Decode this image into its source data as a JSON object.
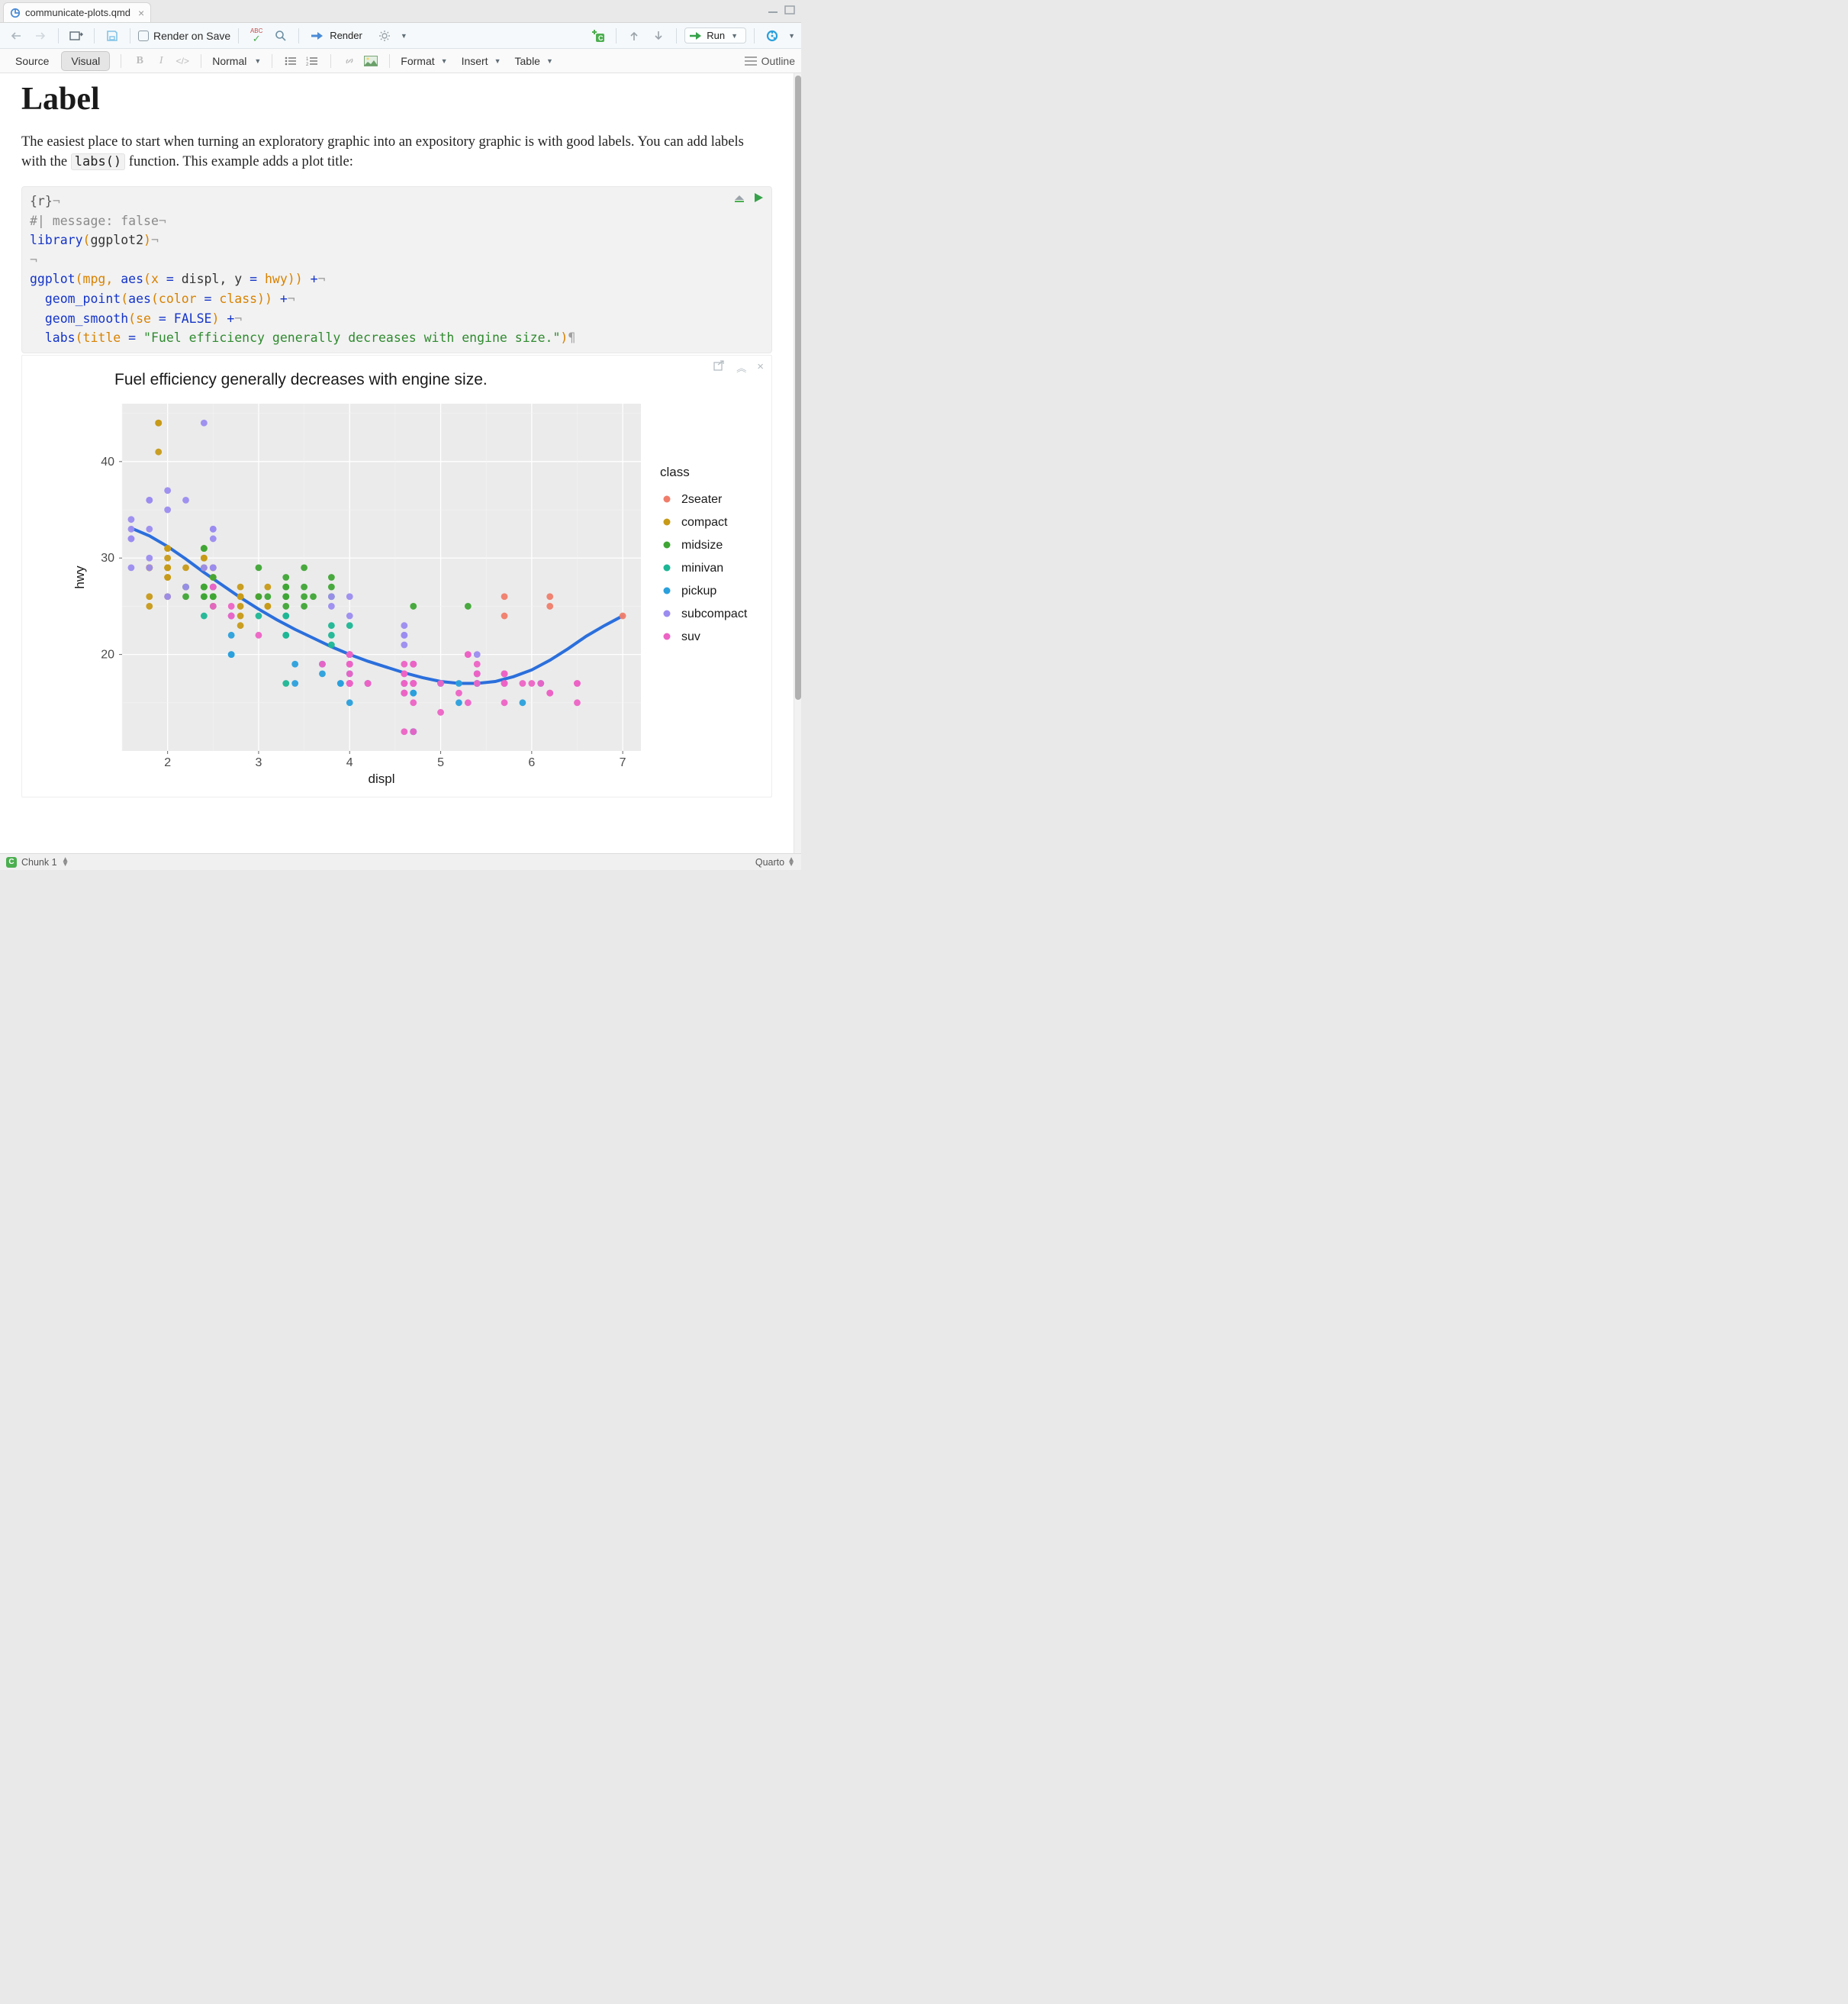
{
  "tab": {
    "filename": "communicate-plots.qmd"
  },
  "toolbar": {
    "render_on_save": "Render on Save",
    "render": "Render",
    "run": "Run"
  },
  "toolbar2": {
    "source": "Source",
    "visual": "Visual",
    "style_select": "Normal",
    "format": "Format",
    "insert": "Insert",
    "table": "Table",
    "outline": "Outline"
  },
  "page": {
    "heading": "Label",
    "para_pre": "The easiest place to start when turning an exploratory graphic into an expository graphic is with good labels. You can add labels with the ",
    "para_code": "labs()",
    "para_post": " function. This example adds a plot title:"
  },
  "code": {
    "l1": "{r}",
    "l2": "#| message: false",
    "l3a": "library",
    "l3b": "(",
    "l3c": "ggplot2",
    "l3d": ")",
    "l5a": "ggplot",
    "l5b": "(mpg, ",
    "l5c": "aes",
    "l5d": "(x ",
    "l5e": "=",
    "l5f": " displ, y ",
    "l5g": "=",
    "l5h": " hwy)) ",
    "l5i": "+",
    "l6a": "  geom_point",
    "l6b": "(",
    "l6c": "aes",
    "l6d": "(color ",
    "l6e": "=",
    "l6f": " class)) ",
    "l6g": "+",
    "l7a": "  geom_smooth",
    "l7b": "(se ",
    "l7c": "=",
    "l7d": " ",
    "l7e": "FALSE",
    "l7f": ") ",
    "l7g": "+",
    "l8a": "  labs",
    "l8b": "(title ",
    "l8c": "=",
    "l8d": " ",
    "l8e": "\"Fuel efficiency generally decreases with engine size.\"",
    "l8f": ")"
  },
  "status": {
    "chunk": "Chunk 1",
    "engine": "Quarto"
  },
  "chart_data": {
    "type": "scatter",
    "title": "Fuel efficiency generally decreases with engine size.",
    "xlabel": "displ",
    "ylabel": "hwy",
    "xlim": [
      1.5,
      7.2
    ],
    "ylim": [
      10,
      46
    ],
    "x_ticks": [
      2,
      3,
      4,
      5,
      6,
      7
    ],
    "y_ticks": [
      20,
      30,
      40
    ],
    "legend_title": "class",
    "series": [
      {
        "name": "2seater",
        "color": "#f07d6a",
        "points": [
          [
            5.7,
            26
          ],
          [
            5.7,
            24
          ],
          [
            6.2,
            26
          ],
          [
            6.2,
            25
          ],
          [
            7.0,
            24
          ]
        ]
      },
      {
        "name": "compact",
        "color": "#c79a17",
        "points": [
          [
            1.8,
            29
          ],
          [
            1.8,
            29
          ],
          [
            2.0,
            31
          ],
          [
            2.0,
            30
          ],
          [
            2.8,
            26
          ],
          [
            2.8,
            26
          ],
          [
            3.1,
            27
          ],
          [
            1.8,
            26
          ],
          [
            1.8,
            25
          ],
          [
            2.0,
            28
          ],
          [
            2.0,
            29
          ],
          [
            2.8,
            27
          ],
          [
            2.8,
            25
          ],
          [
            3.1,
            25
          ],
          [
            3.1,
            25
          ],
          [
            2.4,
            30
          ],
          [
            2.4,
            30
          ],
          [
            2.5,
            26
          ],
          [
            2.5,
            27
          ],
          [
            2.2,
            27
          ],
          [
            2.2,
            29
          ],
          [
            2.4,
            31
          ],
          [
            2.4,
            30
          ],
          [
            3.0,
            26
          ],
          [
            1.8,
            29
          ],
          [
            1.8,
            29
          ],
          [
            1.8,
            29
          ],
          [
            1.8,
            29
          ],
          [
            1.8,
            29
          ],
          [
            2.0,
            28
          ],
          [
            2.0,
            29
          ],
          [
            1.9,
            44
          ],
          [
            1.9,
            41
          ],
          [
            2.0,
            29
          ],
          [
            2.0,
            26
          ],
          [
            2.5,
            29
          ],
          [
            2.5,
            29
          ],
          [
            2.8,
            23
          ],
          [
            2.8,
            24
          ],
          [
            1.9,
            44
          ],
          [
            1.9,
            44
          ],
          [
            2.0,
            31
          ],
          [
            2.0,
            29
          ],
          [
            2.4,
            29
          ],
          [
            2.4,
            29
          ],
          [
            2.5,
            28
          ],
          [
            2.5,
            29
          ]
        ]
      },
      {
        "name": "midsize",
        "color": "#3fa535",
        "points": [
          [
            2.4,
            27
          ],
          [
            2.4,
            27
          ],
          [
            3.1,
            26
          ],
          [
            3.5,
            29
          ],
          [
            3.6,
            26
          ],
          [
            2.4,
            26
          ],
          [
            2.4,
            27
          ],
          [
            3.3,
            28
          ],
          [
            3.3,
            26
          ],
          [
            3.3,
            27
          ],
          [
            3.8,
            26
          ],
          [
            3.8,
            28
          ],
          [
            3.8,
            27
          ],
          [
            2.2,
            26
          ],
          [
            2.2,
            27
          ],
          [
            2.4,
            27
          ],
          [
            2.4,
            26
          ],
          [
            3.0,
            26
          ],
          [
            3.3,
            27
          ],
          [
            3.5,
            26
          ],
          [
            2.5,
            27
          ],
          [
            2.5,
            25
          ],
          [
            3.3,
            25
          ],
          [
            2.5,
            26
          ],
          [
            2.5,
            28
          ],
          [
            3.5,
            27
          ],
          [
            2.4,
            31
          ],
          [
            2.4,
            31
          ],
          [
            2.5,
            26
          ],
          [
            2.5,
            26
          ],
          [
            3.5,
            25
          ],
          [
            3.0,
            29
          ],
          [
            3.3,
            26
          ],
          [
            4.7,
            25
          ],
          [
            5.3,
            25
          ]
        ]
      },
      {
        "name": "minivan",
        "color": "#1db695",
        "points": [
          [
            2.4,
            24
          ],
          [
            3.0,
            24
          ],
          [
            3.3,
            22
          ],
          [
            3.3,
            22
          ],
          [
            3.3,
            24
          ],
          [
            3.3,
            24
          ],
          [
            3.3,
            17
          ],
          [
            3.8,
            22
          ],
          [
            3.8,
            21
          ],
          [
            3.8,
            23
          ],
          [
            4.0,
            23
          ]
        ]
      },
      {
        "name": "pickup",
        "color": "#2aa0dc",
        "points": [
          [
            3.7,
            19
          ],
          [
            3.7,
            18
          ],
          [
            3.9,
            17
          ],
          [
            3.9,
            17
          ],
          [
            4.7,
            19
          ],
          [
            4.7,
            19
          ],
          [
            4.7,
            12
          ],
          [
            5.2,
            17
          ],
          [
            5.2,
            15
          ],
          [
            5.7,
            17
          ],
          [
            5.9,
            15
          ],
          [
            4.7,
            16
          ],
          [
            4.7,
            12
          ],
          [
            4.7,
            17
          ],
          [
            4.7,
            17
          ],
          [
            4.7,
            16
          ],
          [
            4.7,
            12
          ],
          [
            5.7,
            18
          ],
          [
            6.1,
            17
          ],
          [
            4.0,
            20
          ],
          [
            4.0,
            17
          ],
          [
            4.0,
            19
          ],
          [
            4.0,
            20
          ],
          [
            4.6,
            17
          ],
          [
            5.0,
            17
          ],
          [
            4.2,
            17
          ],
          [
            4.2,
            17
          ],
          [
            4.6,
            16
          ],
          [
            4.6,
            16
          ],
          [
            4.6,
            17
          ],
          [
            5.4,
            17
          ],
          [
            5.4,
            18
          ],
          [
            2.7,
            20
          ],
          [
            2.7,
            20
          ],
          [
            2.7,
            22
          ],
          [
            3.4,
            17
          ],
          [
            3.4,
            19
          ],
          [
            4.0,
            20
          ],
          [
            4.0,
            15
          ],
          [
            4.0,
            18
          ],
          [
            5.4,
            18
          ],
          [
            5.4,
            17
          ]
        ]
      },
      {
        "name": "subcompact",
        "color": "#9b8cf0",
        "points": [
          [
            3.8,
            26
          ],
          [
            3.8,
            25
          ],
          [
            4.0,
            26
          ],
          [
            4.0,
            24
          ],
          [
            4.6,
            21
          ],
          [
            4.6,
            22
          ],
          [
            4.6,
            23
          ],
          [
            4.6,
            22
          ],
          [
            5.4,
            20
          ],
          [
            1.6,
            33
          ],
          [
            1.6,
            32
          ],
          [
            1.6,
            32
          ],
          [
            1.6,
            29
          ],
          [
            1.6,
            34
          ],
          [
            1.8,
            36
          ],
          [
            1.8,
            36
          ],
          [
            1.8,
            29
          ],
          [
            2.0,
            26
          ],
          [
            2.4,
            44
          ],
          [
            2.4,
            29
          ],
          [
            2.5,
            33
          ],
          [
            2.5,
            33
          ],
          [
            2.5,
            29
          ],
          [
            2.5,
            32
          ],
          [
            2.2,
            36
          ],
          [
            2.2,
            27
          ],
          [
            2.5,
            29
          ],
          [
            2.5,
            27
          ],
          [
            1.8,
            30
          ],
          [
            1.8,
            33
          ],
          [
            2.0,
            35
          ],
          [
            2.0,
            37
          ],
          [
            2.7,
            24
          ],
          [
            2.7,
            24
          ],
          [
            2.7,
            24
          ]
        ]
      },
      {
        "name": "suv",
        "color": "#ed63c5",
        "points": [
          [
            5.3,
            20
          ],
          [
            5.3,
            15
          ],
          [
            5.3,
            20
          ],
          [
            5.7,
            17
          ],
          [
            6.0,
            17
          ],
          [
            5.7,
            15
          ],
          [
            5.7,
            18
          ],
          [
            6.2,
            16
          ],
          [
            6.2,
            16
          ],
          [
            6.5,
            17
          ],
          [
            4.0,
            17
          ],
          [
            4.0,
            19
          ],
          [
            4.0,
            18
          ],
          [
            4.0,
            17
          ],
          [
            4.6,
            19
          ],
          [
            5.0,
            17
          ],
          [
            4.2,
            17
          ],
          [
            4.2,
            17
          ],
          [
            4.6,
            16
          ],
          [
            4.6,
            16
          ],
          [
            4.6,
            17
          ],
          [
            5.4,
            17
          ],
          [
            5.4,
            18
          ],
          [
            4.0,
            17
          ],
          [
            4.0,
            19
          ],
          [
            4.7,
            12
          ],
          [
            4.7,
            17
          ],
          [
            4.7,
            15
          ],
          [
            5.2,
            16
          ],
          [
            5.7,
            18
          ],
          [
            5.9,
            17
          ],
          [
            4.6,
            12
          ],
          [
            5.4,
            18
          ],
          [
            5.4,
            19
          ],
          [
            4.0,
            19
          ],
          [
            4.0,
            20
          ],
          [
            4.0,
            17
          ],
          [
            4.0,
            20
          ],
          [
            4.7,
            17
          ],
          [
            4.7,
            17
          ],
          [
            5.7,
            18
          ],
          [
            6.1,
            17
          ],
          [
            4.0,
            17
          ],
          [
            4.0,
            17
          ],
          [
            4.0,
            17
          ],
          [
            4.6,
            18
          ],
          [
            4.6,
            17
          ],
          [
            4.6,
            18
          ],
          [
            5.0,
            14
          ],
          [
            3.0,
            22
          ],
          [
            3.7,
            19
          ],
          [
            4.0,
            20
          ],
          [
            4.7,
            17
          ],
          [
            4.7,
            19
          ],
          [
            4.7,
            19
          ],
          [
            5.7,
            17
          ],
          [
            6.5,
            15
          ],
          [
            6.5,
            17
          ],
          [
            2.5,
            25
          ],
          [
            2.5,
            27
          ],
          [
            2.7,
            25
          ],
          [
            2.7,
            24
          ]
        ]
      }
    ],
    "smooth_line": [
      [
        1.6,
        33.1
      ],
      [
        1.8,
        32.3
      ],
      [
        2.0,
        31.2
      ],
      [
        2.2,
        29.9
      ],
      [
        2.4,
        28.5
      ],
      [
        2.6,
        27.2
      ],
      [
        2.8,
        25.9
      ],
      [
        3.0,
        24.7
      ],
      [
        3.2,
        23.6
      ],
      [
        3.4,
        22.6
      ],
      [
        3.6,
        21.7
      ],
      [
        3.8,
        20.8
      ],
      [
        4.0,
        20.0
      ],
      [
        4.2,
        19.3
      ],
      [
        4.4,
        18.7
      ],
      [
        4.6,
        18.1
      ],
      [
        4.8,
        17.6
      ],
      [
        5.0,
        17.2
      ],
      [
        5.2,
        17.0
      ],
      [
        5.4,
        17.0
      ],
      [
        5.6,
        17.2
      ],
      [
        5.8,
        17.7
      ],
      [
        6.0,
        18.4
      ],
      [
        6.2,
        19.4
      ],
      [
        6.4,
        20.6
      ],
      [
        6.6,
        21.9
      ],
      [
        6.8,
        23.0
      ],
      [
        7.0,
        24.0
      ]
    ]
  }
}
